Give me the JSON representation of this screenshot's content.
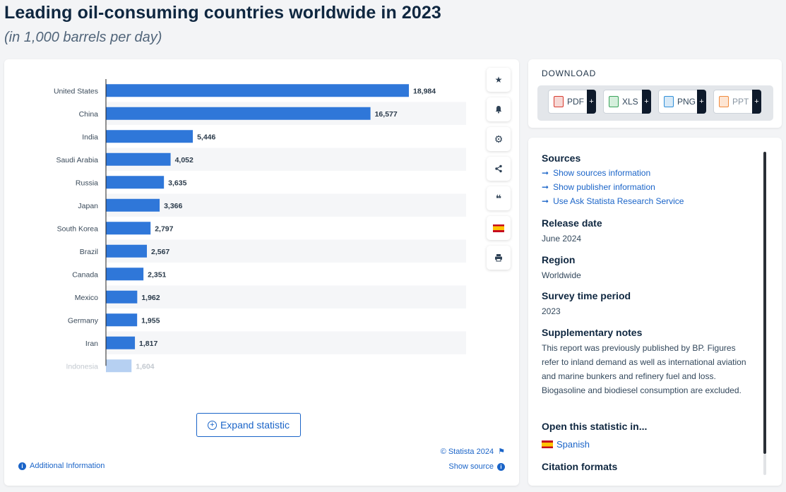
{
  "header": {
    "title": "Leading oil-consuming countries worldwide in 2023",
    "subtitle": "(in 1,000 barrels per day)"
  },
  "chart_data": {
    "type": "bar",
    "orientation": "horizontal",
    "categories": [
      "United States",
      "China",
      "India",
      "Saudi Arabia",
      "Russia",
      "Japan",
      "South Korea",
      "Brazil",
      "Canada",
      "Mexico",
      "Germany",
      "Iran",
      "Indonesia"
    ],
    "values": [
      18984,
      16577,
      5446,
      4052,
      3635,
      3366,
      2797,
      2567,
      2351,
      1962,
      1955,
      1817,
      1604
    ],
    "value_labels": [
      "18,984",
      "16,577",
      "5,446",
      "4,052",
      "3,635",
      "3,366",
      "2,797",
      "2,567",
      "2,351",
      "1,962",
      "1,955",
      "1,817",
      "1,604"
    ],
    "title": "Leading oil-consuming countries worldwide in 2023",
    "subtitle": "(in 1,000 barrels per day)",
    "xlim": [
      0,
      20000
    ],
    "grid": false,
    "bar_color": "#2f77d9"
  },
  "toolbar": {
    "icons": [
      "star-icon",
      "bell-icon",
      "gear-icon",
      "share-icon",
      "quote-icon",
      "spanish-flag-icon",
      "print-icon"
    ]
  },
  "chart_footer": {
    "expand_label": "Expand statistic",
    "copyright": "© Statista 2024",
    "show_source": "Show source",
    "additional_info": "Additional Information"
  },
  "download": {
    "title": "DOWNLOAD",
    "buttons": [
      {
        "label": "PDF",
        "color": "#d83a2f"
      },
      {
        "label": "XLS",
        "color": "#3aa35b"
      },
      {
        "label": "PNG",
        "color": "#2f8fd8"
      },
      {
        "label": "PPT",
        "color": "#f08a3c"
      }
    ]
  },
  "info": {
    "sources_heading": "Sources",
    "links": [
      "Show sources information",
      "Show publisher information",
      "Use Ask Statista Research Service"
    ],
    "release_heading": "Release date",
    "release_value": "June 2024",
    "region_heading": "Region",
    "region_value": "Worldwide",
    "survey_heading": "Survey time period",
    "survey_value": "2023",
    "notes_heading": "Supplementary notes",
    "notes_text": "This report was previously published by BP. Figures refer to inland demand as well as international aviation and marine bunkers and refinery fuel and loss. Biogasoline and biodiesel consumption are excluded.",
    "open_heading": "Open this statistic in...",
    "open_language": "Spanish",
    "citation_heading": "Citation formats"
  },
  "colors": {
    "accent": "#1a64c8",
    "bar": "#2f77d9",
    "title": "#0f2740"
  }
}
